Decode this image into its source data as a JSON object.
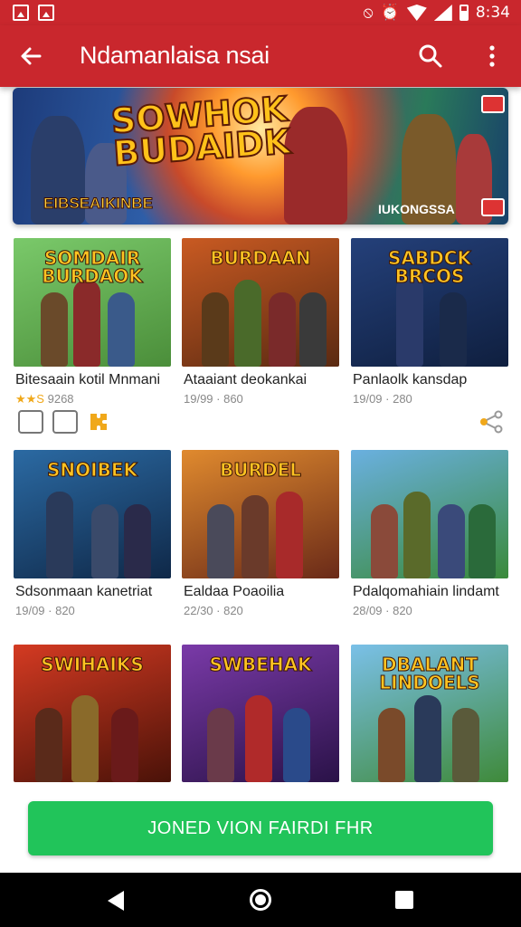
{
  "status_bar": {
    "time": "8:34"
  },
  "app_bar": {
    "title": "Ndamanlaisa nsai"
  },
  "banner": {
    "title_line1": "SOWHOK",
    "title_line2": "BUDAIDK",
    "subtitle": "EIBSEAIKINBE",
    "subtitle_right": "IUKONGSSA"
  },
  "cards": [
    {
      "thumb_title": "SOMDAIR BURDAOK",
      "name": "Bitesaain kotil Mnmani",
      "meta": "9268",
      "stars": "★★S",
      "colors": [
        "#7ac96a",
        "#4b8e3a"
      ]
    },
    {
      "thumb_title": "BURDAAN",
      "name": "Ataaiant deokankai",
      "meta": "19/99 · 860",
      "stars": "",
      "colors": [
        "#c95a22",
        "#5a2a12"
      ]
    },
    {
      "thumb_title": "SABDCK BRCOS",
      "name": "Panlaolk kansdap",
      "meta": "19/09 · 280",
      "stars": "",
      "colors": [
        "#24407a",
        "#0f1f3f"
      ]
    },
    {
      "thumb_title": "SNOIBEK",
      "name": "Sdsonmaan kanetriat",
      "meta": "19/09 · 820",
      "stars": "",
      "colors": [
        "#2b6aa3",
        "#0f2848"
      ]
    },
    {
      "thumb_title": "BURDEL",
      "name": "Ealdaa Poaoilia",
      "meta": "22/30 · 820",
      "stars": "",
      "colors": [
        "#e08a2e",
        "#6a2a18"
      ]
    },
    {
      "thumb_title": "",
      "name": "Pdalqomahiain lindamt",
      "meta": "28/09 · 820",
      "stars": "",
      "colors": [
        "#6ab0e0",
        "#3a8a3a"
      ]
    },
    {
      "thumb_title": "SWIHAIKS",
      "name": "",
      "meta": "",
      "stars": "",
      "colors": [
        "#d43a22",
        "#4a1208"
      ]
    },
    {
      "thumb_title": "SWBEHAK",
      "name": "",
      "meta": "",
      "stars": "",
      "colors": [
        "#7a3aa8",
        "#2a1248"
      ]
    },
    {
      "thumb_title": "DBALANT LINDOELS",
      "name": "",
      "meta": "",
      "stars": "",
      "colors": [
        "#7ac0e8",
        "#3f8a3a"
      ]
    }
  ],
  "cta": {
    "label": "JONED VION FAIRDI FHR"
  },
  "colors": {
    "primary": "#c9272d",
    "cta": "#21c45a"
  }
}
